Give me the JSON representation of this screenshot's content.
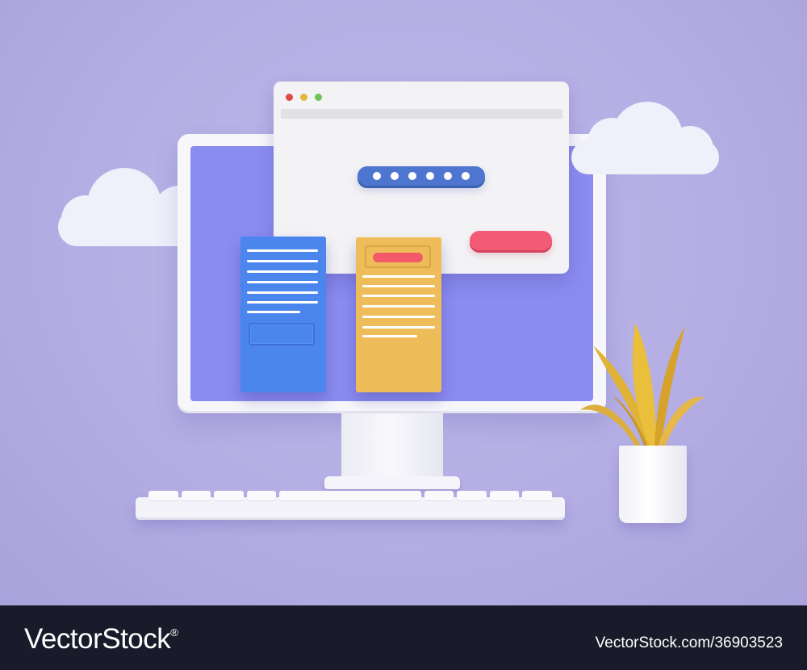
{
  "colors": {
    "background": "#b4aee4",
    "screen": "#8b8cf0",
    "accent_blue": "#4a86ee",
    "accent_orange": "#eebd5a",
    "accent_red": "#f25a76",
    "password_field": "#4e76d0",
    "footer": "#1a1b2a"
  },
  "browser_window": {
    "controls": [
      "close-dot",
      "minimize-dot",
      "maximize-dot"
    ],
    "password_mask_length": 6
  },
  "icons": {
    "clouds": [
      "cloud-icon",
      "cloud-icon"
    ],
    "plant": "plant-icon"
  },
  "watermark": {
    "brand": "VectorStock",
    "registered_mark": "®",
    "image_id": "VectorStock.com/36903523"
  }
}
